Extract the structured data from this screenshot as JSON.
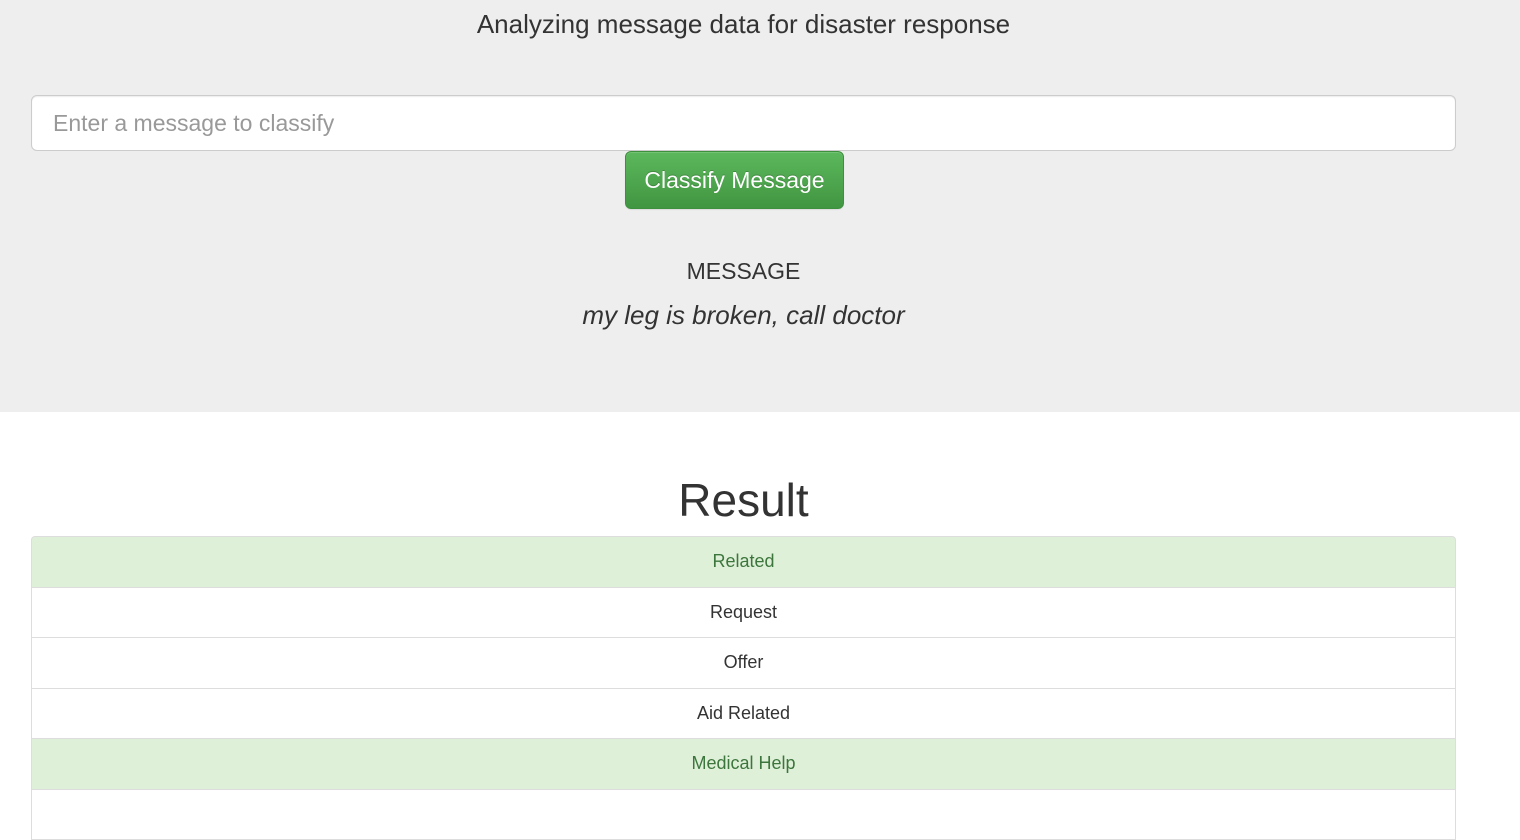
{
  "header": {
    "subtitle": "Analyzing message data for disaster response"
  },
  "form": {
    "input_placeholder": "Enter a message to classify",
    "input_value": "",
    "button_label": "Classify Message"
  },
  "message": {
    "label": "MESSAGE",
    "text": "my leg is broken, call doctor"
  },
  "result": {
    "title": "Result",
    "items": [
      {
        "label": "Related",
        "positive": true
      },
      {
        "label": "Request",
        "positive": false
      },
      {
        "label": "Offer",
        "positive": false
      },
      {
        "label": "Aid Related",
        "positive": false
      },
      {
        "label": "Medical Help",
        "positive": true
      },
      {
        "label": "",
        "positive": false
      }
    ]
  },
  "colors": {
    "jumbotron_bg": "#eeeeee",
    "positive_bg": "#dff0d8",
    "positive_text": "#3c763d",
    "button_green": "#5cb85c"
  }
}
